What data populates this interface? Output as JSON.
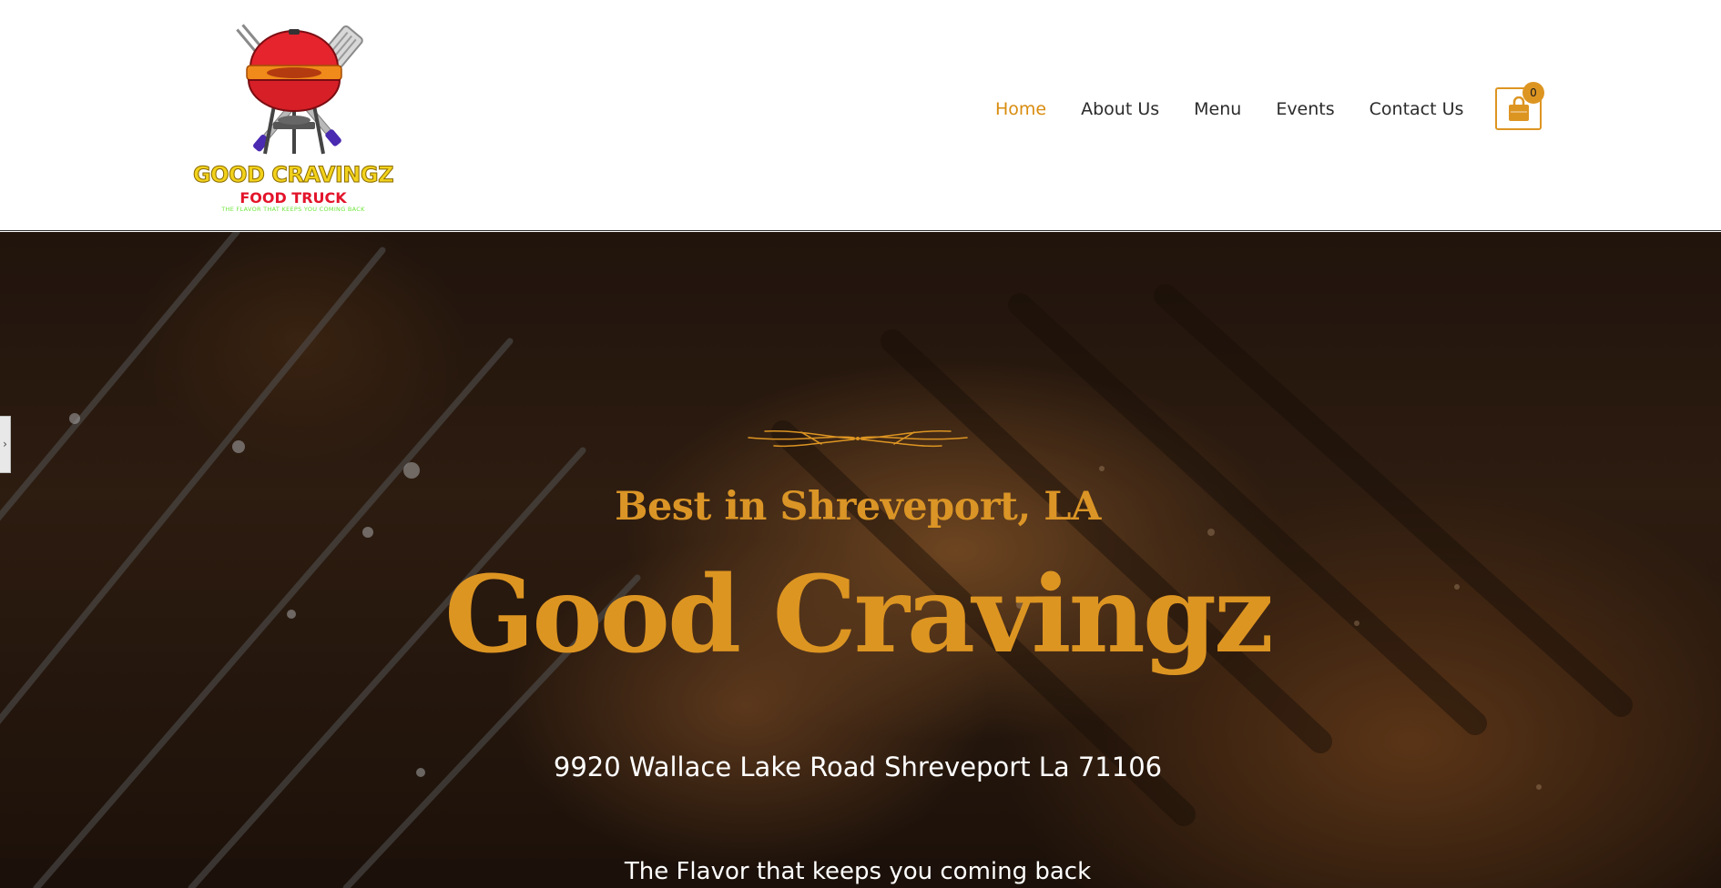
{
  "logo": {
    "line1": "GOOD CRAVINGZ",
    "line2": "FOOD TRUCK",
    "line3": "THE FLAVOR THAT KEEPS YOU COMING BACK",
    "icon": "grill-with-spatulas-logo"
  },
  "nav": {
    "items": [
      {
        "label": "Home",
        "active": true
      },
      {
        "label": "About Us",
        "active": false
      },
      {
        "label": "Menu",
        "active": false
      },
      {
        "label": "Events",
        "active": false
      },
      {
        "label": "Contact Us",
        "active": false
      }
    ]
  },
  "cart": {
    "icon": "shopping-bag-icon",
    "count": "0"
  },
  "side_tab": {
    "icon": "chevron-right-icon",
    "glyph": "›"
  },
  "hero": {
    "subtitle": "Best in Shreveport, LA",
    "title": "Good Cravingz",
    "address": "9920 Wallace Lake Road Shreveport La 71106",
    "tagline": "The Flavor that keeps you coming back",
    "ornament_icon": "decorative-flourish-icon"
  },
  "colors": {
    "accent": "#dd9522",
    "nav_text": "#2b2b2b",
    "hero_text": "#ffffff"
  }
}
